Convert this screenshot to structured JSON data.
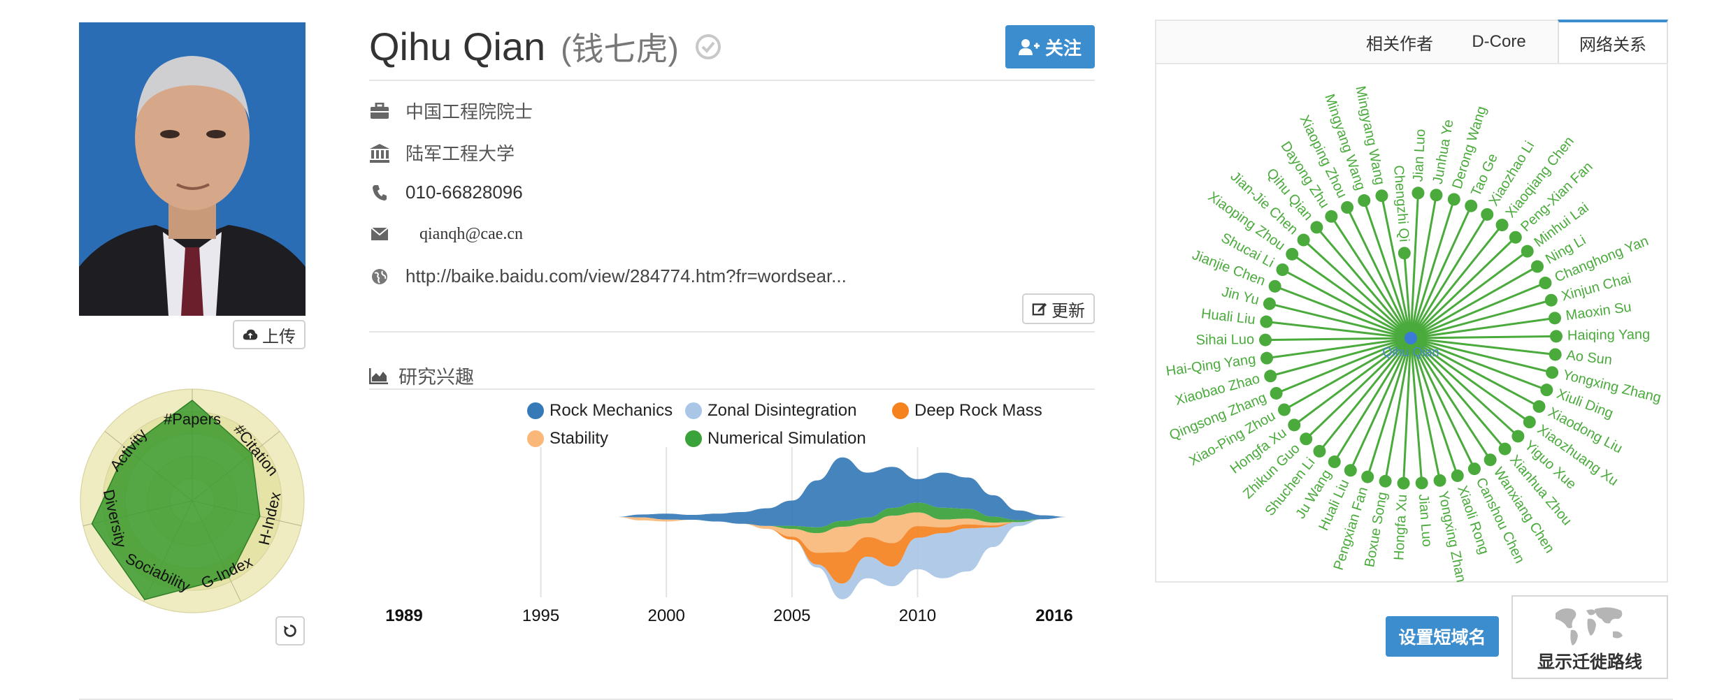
{
  "profile": {
    "name": "Qihu Qian",
    "name_cn": "(钱七虎)",
    "follow_label": "关注",
    "title": "中国工程院院士",
    "affiliation": "陆军工程大学",
    "phone": "010-66828096",
    "email": "qianqh@cae.cn",
    "homepage": "http://baike.baidu.com/view/284774.htm?fr=wordsear...",
    "update_label": "更新",
    "upload_label": "上传"
  },
  "radar": {
    "axes": [
      "#Papers",
      "#Citation",
      "H-Index",
      "G-Index",
      "Sociability",
      "Diversity",
      "Activity"
    ],
    "values": [
      0.9,
      0.68,
      0.62,
      0.76,
      0.98,
      0.92,
      0.75
    ],
    "color": "#3a9a2e"
  },
  "research": {
    "title": "研究兴趣",
    "legend": [
      {
        "name": "Rock Mechanics",
        "color": "#3579b6"
      },
      {
        "name": "Zonal Disintegration",
        "color": "#a9c6e6"
      },
      {
        "name": "Deep Rock Mass",
        "color": "#f5821f"
      },
      {
        "name": "Stability",
        "color": "#f9b87a"
      },
      {
        "name": "Numerical Simulation",
        "color": "#3aa23a"
      }
    ]
  },
  "chart_data": {
    "type": "area",
    "x": [
      1998,
      1999,
      2000,
      2001,
      2002,
      2003,
      2004,
      2005,
      2006,
      2007,
      2008,
      2009,
      2010,
      2011,
      2012,
      2013,
      2014,
      2015,
      2016
    ],
    "x_tick_labels": [
      "1989",
      "1995",
      "2000",
      "2005",
      "2010",
      "2016"
    ],
    "x_tick_values": [
      1989,
      1995,
      2000,
      2005,
      2010,
      2016
    ],
    "xlim": [
      1989,
      2016
    ],
    "series": [
      {
        "name": "Rock Mechanics",
        "values": [
          0,
          0.3,
          0.6,
          0.5,
          0.8,
          1.2,
          1.8,
          2.6,
          4.8,
          6.5,
          4.6,
          4.2,
          2.4,
          3.6,
          3.2,
          2.2,
          1.0,
          0.4,
          0
        ]
      },
      {
        "name": "Zonal Disintegration",
        "values": [
          0,
          0,
          0,
          0,
          0,
          0,
          0,
          0,
          0.3,
          1.6,
          2.2,
          2.0,
          3.2,
          4.6,
          4.4,
          2.0,
          0.4,
          0,
          0
        ]
      },
      {
        "name": "Deep Rock Mass",
        "values": [
          0,
          0,
          0,
          0,
          0,
          0,
          0,
          0.3,
          1.2,
          3.2,
          2.0,
          2.4,
          1.2,
          0.6,
          0.4,
          0.2,
          0,
          0,
          0
        ]
      },
      {
        "name": "Stability",
        "values": [
          0,
          0.3,
          0.2,
          0,
          0,
          0,
          0.3,
          0.8,
          2.0,
          2.6,
          1.4,
          2.8,
          1.4,
          0.8,
          0.6,
          0.3,
          0,
          0,
          0
        ]
      },
      {
        "name": "Numerical Simulation",
        "values": [
          0,
          0,
          0,
          0,
          0,
          0,
          0,
          0.3,
          0.6,
          0.6,
          0.6,
          0.8,
          1.0,
          1.2,
          1.0,
          0.6,
          0.2,
          0,
          0
        ]
      }
    ],
    "grid": true
  },
  "network": {
    "tabs": [
      "相关作者",
      "D-Core",
      "网络关系"
    ],
    "active_tab": "网络关系",
    "center": "Qihu Qian",
    "color": "#4aaa3c",
    "center_color": "#3a7bd5",
    "nodes": [
      {
        "name": "Chengzhi Qi",
        "inner": true
      },
      {
        "name": "Jian Luo"
      },
      {
        "name": "Junhua Ye"
      },
      {
        "name": "Derong Wang"
      },
      {
        "name": "Tao Ge"
      },
      {
        "name": "Xiaozhao Li"
      },
      {
        "name": "Xiaoqiang Chen"
      },
      {
        "name": "Peng-Xian Fan"
      },
      {
        "name": "Minhui Lai"
      },
      {
        "name": "Ning Li"
      },
      {
        "name": "Changhong Yan"
      },
      {
        "name": "Xinjun Chai"
      },
      {
        "name": "Maoxin Su"
      },
      {
        "name": "Haiqing Yang"
      },
      {
        "name": "Ao Sun"
      },
      {
        "name": "Yongxing Zhang"
      },
      {
        "name": "Xiuli Ding"
      },
      {
        "name": "Xiaodong Liu"
      },
      {
        "name": "Xiaozhuang Xu"
      },
      {
        "name": "Yiguo Xue"
      },
      {
        "name": "Xianhua Zhou"
      },
      {
        "name": "Wanxiang Chen"
      },
      {
        "name": "Canshou Chen"
      },
      {
        "name": "Xiaoli Rong"
      },
      {
        "name": "Yongxing Zhang"
      },
      {
        "name": "Jian Luo"
      },
      {
        "name": "Hongfa Xu"
      },
      {
        "name": "Boxue Song"
      },
      {
        "name": "Pengxian Fan"
      },
      {
        "name": "Huali Liu"
      },
      {
        "name": "Ju Wang"
      },
      {
        "name": "Shuchen Li"
      },
      {
        "name": "Zhikun Guo"
      },
      {
        "name": "Hongfa Xu"
      },
      {
        "name": "Xiao-Ping Zhou"
      },
      {
        "name": "Qingsong Zhang"
      },
      {
        "name": "Xiaobao Zhao"
      },
      {
        "name": "Hai-Qing Yang"
      },
      {
        "name": "Sihai Luo"
      },
      {
        "name": "Huali Liu"
      },
      {
        "name": "Jin Yu"
      },
      {
        "name": "Jianjie Chen"
      },
      {
        "name": "Shucai Li"
      },
      {
        "name": "Xiaoping Zhou"
      },
      {
        "name": "Jian-Jie Chen"
      },
      {
        "name": "Qihu Qian"
      },
      {
        "name": "Dayong Zhu"
      },
      {
        "name": "Xiaoping Zhou"
      },
      {
        "name": "Mingyang Wang"
      },
      {
        "name": "Mingyang Wang"
      }
    ]
  },
  "actions": {
    "set_domain_label": "设置短域名",
    "migration_label": "显示迁徙路线"
  }
}
